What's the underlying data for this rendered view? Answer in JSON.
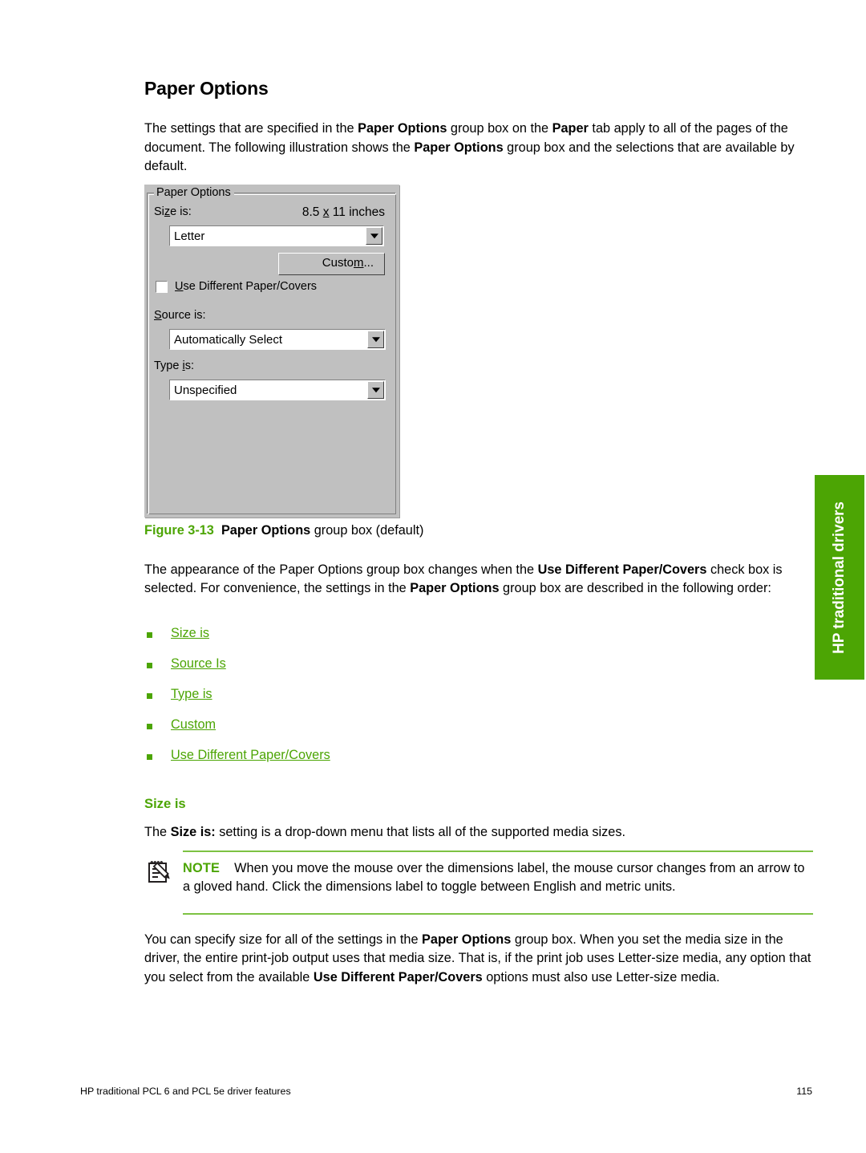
{
  "page": {
    "section_title": "Paper Options",
    "intro_paragraph": {
      "part1": "The settings that are specified in the ",
      "bold1": "Paper Options",
      "part2": " group box on the ",
      "bold2": "Paper",
      "part3": " tab apply to all of the pages of the document. The following illustration shows the ",
      "bold3": "Paper Options",
      "part4": " group box and the selections that are available by default."
    }
  },
  "dialog": {
    "group_title": "Paper Options",
    "size_label": "Size is:",
    "dimensions": "8.5 x 11 inches",
    "size_value": "Letter",
    "custom_button": "Custom...",
    "checkbox_label": "Use Different Paper/Covers",
    "checkbox_checked": false,
    "source_label": "Source is:",
    "source_value": "Automatically Select",
    "type_label": "Type is:",
    "type_value": "Unspecified"
  },
  "figure": {
    "number": "Figure 3-13",
    "bold_part": "Paper Options",
    "rest": " group box (default)"
  },
  "after_figure": {
    "part1": "The appearance of the Paper Options group box changes when the ",
    "bold1": "Use Different Paper/Covers",
    "part2": " check box is selected. For convenience, the settings in the ",
    "bold2": "Paper Options",
    "part3": " group box are described in the following order:"
  },
  "links": [
    {
      "label": "Size is"
    },
    {
      "label": "Source Is"
    },
    {
      "label": "Type is"
    },
    {
      "label": "Custom"
    },
    {
      "label": "Use Different Paper/Covers"
    }
  ],
  "size_is_section": {
    "heading": "Size is",
    "paragraph": {
      "part1": "The ",
      "bold1": "Size is:",
      "part2": " setting is a drop-down menu that lists all of the supported media sizes."
    }
  },
  "note": {
    "keyword": "NOTE",
    "text": "When you move the mouse over the dimensions label, the mouse cursor changes from an arrow to a gloved hand. Click the dimensions label to toggle between English and metric units."
  },
  "closing_paragraph": {
    "part1": "You can specify size for all of the settings in the ",
    "bold1": "Paper Options",
    "part2": " group box. When you set the media size in the driver, the entire print-job output uses that media size. That is, if the print job uses Letter-size media, any option that you select from the available ",
    "bold2": "Use Different Paper/Covers",
    "part3": " options must also use Letter-size media."
  },
  "side_tab": {
    "label": "HP traditional drivers"
  },
  "footer": {
    "left": "HP traditional PCL 6 and PCL 5e driver features",
    "page_number": "115"
  },
  "colors": {
    "hp_green": "#4CA504",
    "rule_green": "#7DC242",
    "dialog_face": "#c0c0c0"
  }
}
